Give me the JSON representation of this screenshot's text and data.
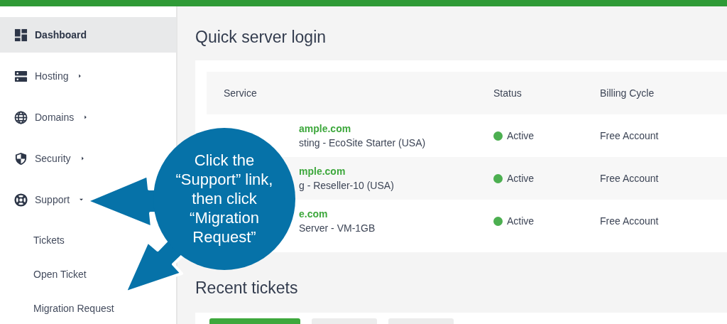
{
  "sidebar": {
    "items": [
      {
        "label": "Dashboard",
        "selected": true
      },
      {
        "label": "Hosting",
        "selected": false,
        "expanded": false
      },
      {
        "label": "Domains",
        "selected": false,
        "expanded": false
      },
      {
        "label": "Security",
        "selected": false,
        "expanded": false
      },
      {
        "label": "Support",
        "selected": false,
        "expanded": true,
        "children": [
          {
            "label": "Tickets"
          },
          {
            "label": "Open Ticket"
          },
          {
            "label": "Migration Request"
          }
        ]
      }
    ]
  },
  "quick_login": {
    "title": "Quick server login",
    "columns": [
      "Service",
      "Status",
      "Billing Cycle"
    ],
    "rows": [
      {
        "domain": "ample.com",
        "plan": "sting - EcoSite Starter (USA)",
        "status": "Active",
        "color": "#4caf50",
        "billing": "Free Account"
      },
      {
        "domain": "mple.com",
        "plan": "g - Reseller-10 (USA)",
        "status": "Active",
        "color": "#4caf50",
        "billing": "Free Account"
      },
      {
        "domain": "e.com",
        "plan": "Server - VM-1GB",
        "status": "Active",
        "color": "#4caf50",
        "billing": "Free Account"
      }
    ]
  },
  "recent_tickets": {
    "title": "Recent tickets",
    "tabs": [
      {
        "selected": true
      },
      {
        "selected": false
      },
      {
        "selected": false
      }
    ]
  },
  "callout": {
    "text": "Click the “Support” link, then click “Migration Request”"
  }
}
